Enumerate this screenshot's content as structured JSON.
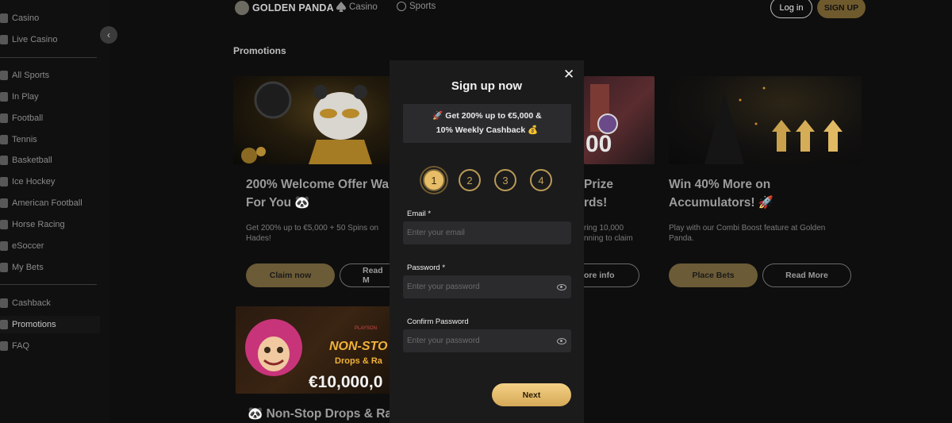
{
  "sidebar": {
    "group1": [
      {
        "label": "Casino",
        "icon": "casino-icon"
      },
      {
        "label": "Live Casino",
        "icon": "live-casino-icon"
      }
    ],
    "group2": [
      {
        "label": "All Sports",
        "icon": "all-sports-icon"
      },
      {
        "label": "In Play",
        "icon": "in-play-icon"
      },
      {
        "label": "Football",
        "icon": "football-icon"
      },
      {
        "label": "Tennis",
        "icon": "tennis-icon"
      },
      {
        "label": "Basketball",
        "icon": "basketball-icon"
      },
      {
        "label": "Ice Hockey",
        "icon": "ice-hockey-icon"
      },
      {
        "label": "American Football",
        "icon": "american-football-icon"
      },
      {
        "label": "Horse Racing",
        "icon": "horse-racing-icon"
      },
      {
        "label": "eSoccer",
        "icon": "esoccer-icon"
      },
      {
        "label": "My Bets",
        "icon": "my-bets-icon"
      }
    ],
    "group3": [
      {
        "label": "Cashback",
        "icon": "cashback-icon"
      },
      {
        "label": "Promotions",
        "icon": "promotions-icon"
      },
      {
        "label": "FAQ",
        "icon": "faq-icon"
      }
    ],
    "collapse_glyph": "‹"
  },
  "header": {
    "logo_text": "GOLDEN PANDA",
    "nav": [
      {
        "label": "Casino",
        "icon": "spade-icon"
      },
      {
        "label": "Sports",
        "icon": "ball-icon"
      }
    ],
    "login_label": "Log in",
    "signup_label": "SIGN UP"
  },
  "page": {
    "title": "Promotions"
  },
  "promos": [
    {
      "title_line1": "200% Welcome Offer Wa",
      "title_line2": "For You 🐼",
      "desc_line1": "Get 200% up to €5,000 + 50 Spins on",
      "desc_line2": "Hades!",
      "primary_label": "Claim now",
      "secondary_label": "Read M"
    },
    {
      "title_line1": "Prize",
      "title_line2": "rds!",
      "desc_line1": "ring 10,000",
      "desc_line2": "nning to claim",
      "secondary_label": "ore info"
    },
    {
      "title_line1": "Win 40% More on",
      "title_line2": "Accumulators! 🚀",
      "desc_line1": "Play with our Combi Boost feature at Golden",
      "desc_line2": "Panda.",
      "primary_label": "Place Bets",
      "secondary_label": "Read More"
    },
    {
      "title_line1": "🐼 Non-Stop Drops & Ra",
      "banner_line1": "NON-STO",
      "banner_line2": "Drops & Ra",
      "banner_amount": "€10,000,0",
      "banner_brand": "PLAYSON"
    }
  ],
  "promo2_img_text": "00",
  "modal": {
    "title": "Sign up now",
    "close_glyph": "✕",
    "offer_line1": "🚀 Get 200% up to €5,000 &",
    "offer_line2": "10% Weekly Cashback 💰",
    "steps": [
      "1",
      "2",
      "3",
      "4"
    ],
    "active_step": 1,
    "email_label": "Email *",
    "email_placeholder": "Enter your email",
    "password_label": "Password *",
    "password_placeholder": "Enter your password",
    "confirm_label": "Confirm Password",
    "confirm_placeholder": "Enter your password",
    "next_label": "Next"
  },
  "colors": {
    "gold": "#e7bd68",
    "background": "#0e0e0e",
    "modal_bg": "#1b1b1c"
  }
}
